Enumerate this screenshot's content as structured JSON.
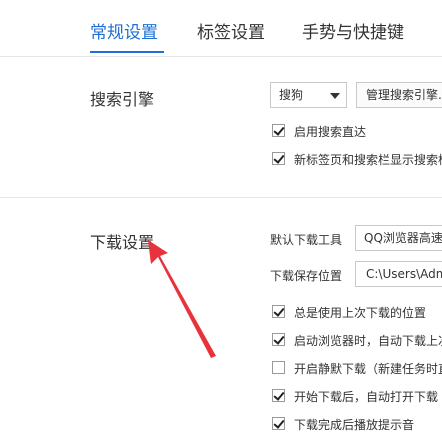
{
  "tabs": [
    {
      "label": "常规设置",
      "active": true
    },
    {
      "label": "标签设置",
      "active": false
    },
    {
      "label": "手势与快捷键",
      "active": false
    }
  ],
  "search_engine": {
    "title": "搜索引擎",
    "engine_select": "搜狗",
    "manage_button": "管理搜索引擎...",
    "options": [
      {
        "label": "启用搜索直达",
        "checked": true
      },
      {
        "label": "新标签页和搜索栏显示搜索框",
        "checked": true
      }
    ]
  },
  "download": {
    "title": "下载设置",
    "default_tool_label": "默认下载工具",
    "default_tool_value": "QQ浏览器高速下载",
    "save_location_label": "下载保存位置",
    "save_location_value": "C:\\Users\\Admin",
    "options": [
      {
        "label": "总是使用上次下载的位置",
        "checked": true
      },
      {
        "label": "启动浏览器时，自动下载上次",
        "checked": true
      },
      {
        "label": "开启静默下载（新建任务时直接",
        "checked": false
      },
      {
        "label": "开始下载后，自动打开下载",
        "checked": true
      },
      {
        "label": "下载完成后播放提示音",
        "checked": true
      }
    ]
  },
  "colors": {
    "accent": "#1f6fd6",
    "annotation_arrow": "#e8323c"
  },
  "icons": {
    "dropdown": "chevron-down-icon",
    "checkbox": "checkmark-icon",
    "annotation": "red-arrow-icon"
  }
}
